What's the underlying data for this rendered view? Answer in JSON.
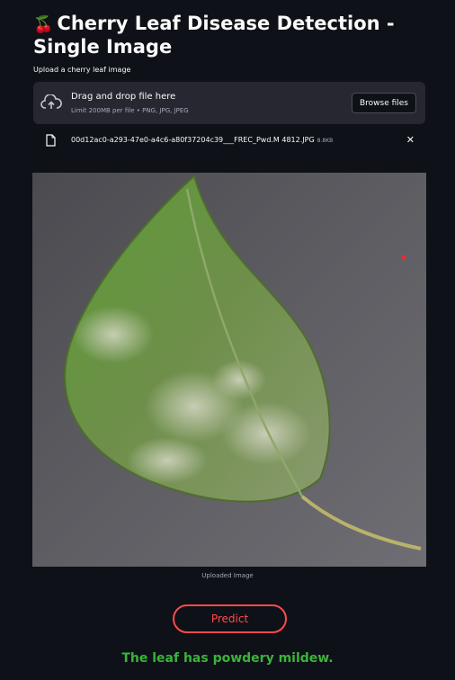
{
  "page": {
    "title": "Cherry Leaf Disease Detection - Single Image",
    "title_emoji": "🍒"
  },
  "uploader": {
    "label": "Upload a cherry leaf image",
    "drop_title": "Drag and drop file here",
    "drop_subtitle": "Limit 200MB per file • PNG, JPG, JPEG",
    "browse_label": "Browse files",
    "icon": "cloud-upload-icon"
  },
  "uploaded_file": {
    "name": "00d12ac0-a293-47e0-a4c6-a80f37204c39___FREC_Pwd.M 4812.JPG",
    "size": "8.8KB",
    "close_symbol": "✕"
  },
  "image": {
    "caption": "Uploaded Image",
    "subject": "cherry leaf with powdery mildew",
    "background_color": "#6f6e74",
    "leaf_color": "#6e9a42"
  },
  "predict": {
    "label": "Predict",
    "accent_color": "#ff4b4b"
  },
  "result": {
    "text": "The leaf has powdery mildew.",
    "color": "#3bb33b"
  }
}
